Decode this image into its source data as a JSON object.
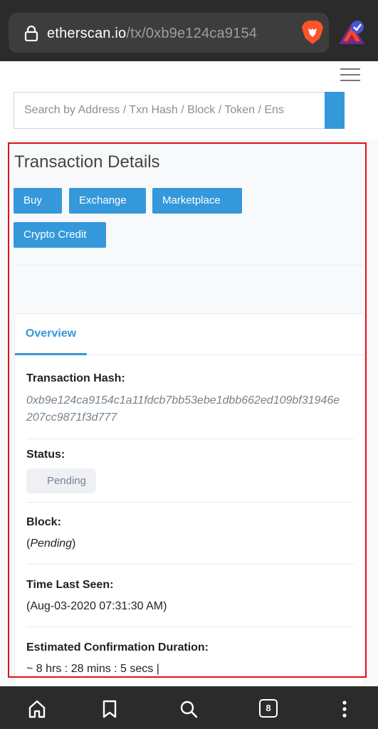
{
  "browser": {
    "url_domain": "etherscan.io",
    "url_path": "/tx/0xb9e124ca9154",
    "tab_count": "8",
    "icons": [
      "lock-icon",
      "brave-lion-icon",
      "bat-rewards-icon"
    ]
  },
  "header": {
    "search_placeholder": "Search by Address / Txn Hash / Block / Token / Ens",
    "menu_icon": "hamburger-menu-icon"
  },
  "page": {
    "title": "Transaction Details",
    "actions": {
      "buy": "Buy",
      "exchange": "Exchange",
      "marketplace": "Marketplace",
      "crypto_credit": "Crypto Credit"
    }
  },
  "card": {
    "tab_overview": "Overview",
    "tx_hash_label": "Transaction Hash:",
    "tx_hash_line1": "0xb9e124ca9154c1a11fdcb7bb53ebe1dbb662ed109bf31946e",
    "tx_hash_line2": "207cc9871f3d777",
    "status_label": "Status:",
    "status_value": "Pending",
    "block_label": "Block:",
    "block_value_open": "(",
    "block_value": "Pending",
    "block_value_close": ")",
    "time_label": "Time Last Seen:",
    "time_value": "(Aug-03-2020 07:31:30 AM)",
    "duration_label": "Estimated Confirmation Duration:",
    "duration_value": "~ 8 hrs : 28 mins : 5 secs |"
  },
  "colors": {
    "accent": "#3498db",
    "highlight_frame": "#e0101a",
    "browser_chrome": "#2b2b2b"
  }
}
